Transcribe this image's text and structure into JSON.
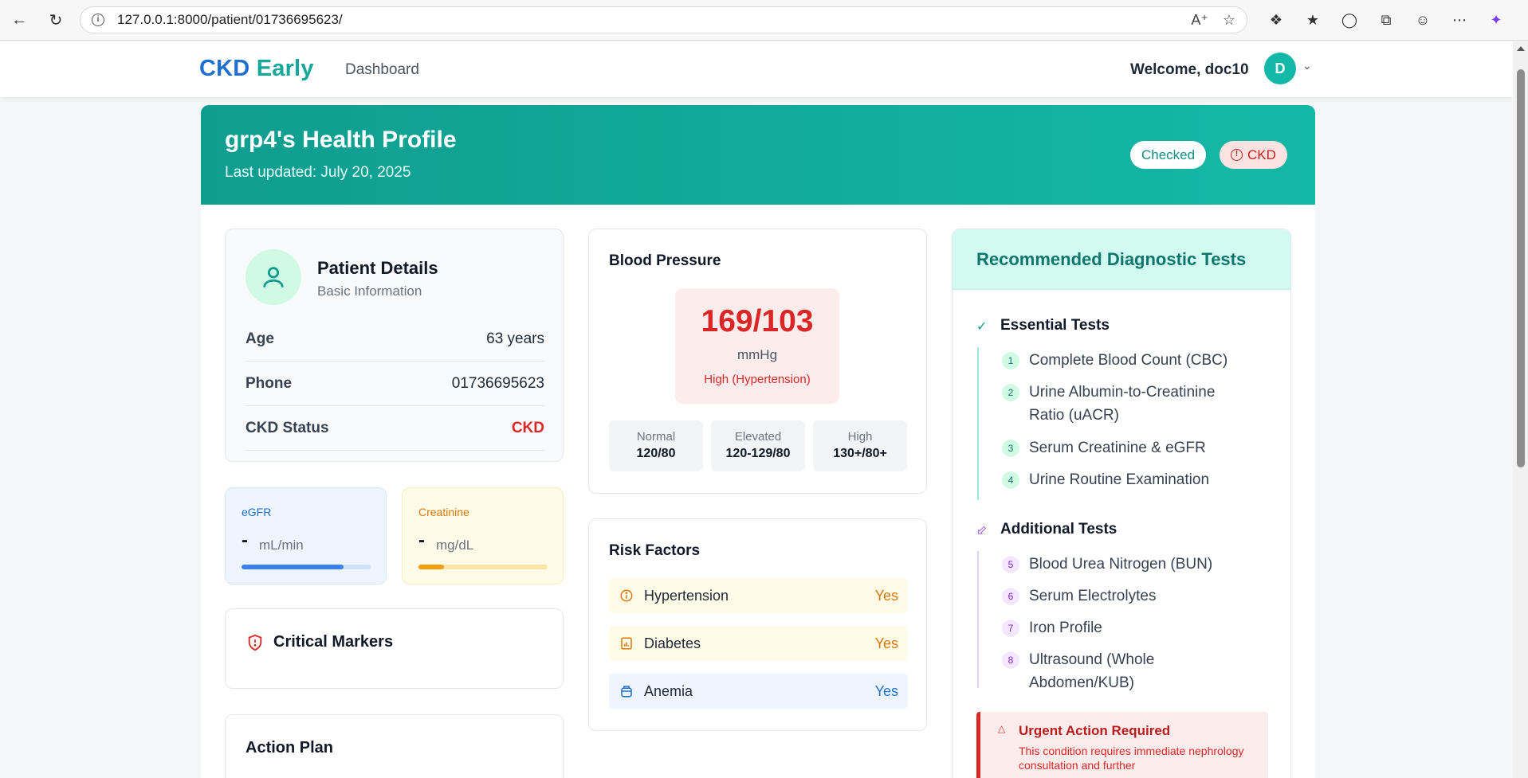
{
  "browser": {
    "url": "127.0.0.1:8000/patient/01736695623/"
  },
  "header": {
    "brand_part1": "CKD",
    "brand_part2": "Early",
    "nav_dashboard": "Dashboard",
    "welcome": "Welcome, doc10",
    "avatar_initial": "D"
  },
  "hero": {
    "title": "grp4's Health Profile",
    "subtitle": "Last updated: July 20, 2025",
    "badge_checked": "Checked",
    "badge_ckd": "CKD"
  },
  "patient": {
    "title": "Patient Details",
    "subtitle": "Basic Information",
    "rows": [
      {
        "label": "Age",
        "value": "63 years"
      },
      {
        "label": "Phone",
        "value": "01736695623"
      },
      {
        "label": "CKD Status",
        "value": "CKD"
      }
    ]
  },
  "metrics": {
    "egfr": {
      "label": "eGFR",
      "value": "-",
      "unit": "mL/min",
      "fill": 0.79
    },
    "creatinine": {
      "label": "Creatinine",
      "value": "-",
      "unit": "mg/dL",
      "fill": 0.2
    }
  },
  "critical_markers": {
    "title": "Critical Markers"
  },
  "action_plan": {
    "title": "Action Plan"
  },
  "blood_pressure": {
    "title": "Blood Pressure",
    "value": "169/103",
    "unit": "mmHg",
    "status": "High (Hypertension)",
    "ranges": [
      {
        "label": "Normal",
        "value": "120/80"
      },
      {
        "label": "Elevated",
        "value": "120-129/80"
      },
      {
        "label": "High",
        "value": "130+/80+"
      }
    ]
  },
  "risk_factors": {
    "title": "Risk Factors",
    "items": [
      {
        "label": "Hypertension",
        "value": "Yes"
      },
      {
        "label": "Diabetes",
        "value": "Yes"
      },
      {
        "label": "Anemia",
        "value": "Yes"
      }
    ]
  },
  "recommended": {
    "title": "Recommended Diagnostic Tests",
    "essential_title": "Essential Tests",
    "essential": [
      {
        "num": "1",
        "label": "Complete Blood Count (CBC)"
      },
      {
        "num": "2",
        "label": "Urine Albumin-to-Creatinine Ratio (uACR)"
      },
      {
        "num": "3",
        "label": "Serum Creatinine & eGFR"
      },
      {
        "num": "4",
        "label": "Urine Routine Examination"
      }
    ],
    "additional_title": "Additional Tests",
    "additional": [
      {
        "num": "5",
        "label": "Blood Urea Nitrogen (BUN)"
      },
      {
        "num": "6",
        "label": "Serum Electrolytes"
      },
      {
        "num": "7",
        "label": "Iron Profile"
      },
      {
        "num": "8",
        "label": "Ultrasound (Whole Abdomen/KUB)"
      }
    ],
    "urgent_title": "Urgent Action Required",
    "urgent_text": "This condition requires immediate nephrology consultation and further"
  },
  "colors": {
    "teal": "#14b8a6",
    "red": "#dc2626",
    "blue": "#1f6fd1",
    "amber": "#d97706"
  }
}
